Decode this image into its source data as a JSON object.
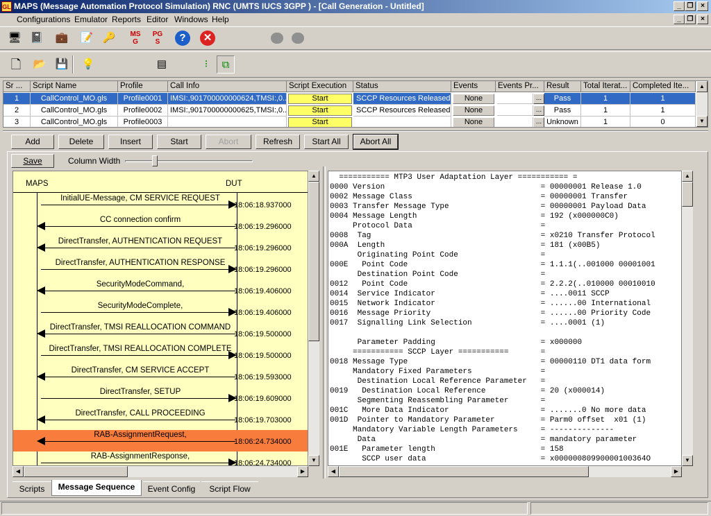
{
  "window": {
    "title": "MAPS (Message Automation Protocol Simulation) RNC (UMTS IUCS 3GPP ) - [Call Generation - Untitled]",
    "logo": "GL"
  },
  "menu": [
    "Configurations",
    "Emulator",
    "Reports",
    "Editor",
    "Windows",
    "Help"
  ],
  "grid": {
    "columns": [
      "Sr ...",
      "Script Name",
      "Profile",
      "Call Info",
      "Script Execution",
      "Status",
      "Events",
      "Events Pr...",
      "Result",
      "Total Iterat...",
      "Completed Ite..."
    ],
    "rows": [
      {
        "sr": "1",
        "script": "CallControl_MO.gls",
        "profile": "Profile0001",
        "callinfo": "IMSI:,901700000000624,TMSI:,0...",
        "exec": "Start",
        "status": "SCCP Resources Released",
        "events": "None",
        "result": "Pass",
        "total": "1",
        "completed": "1"
      },
      {
        "sr": "2",
        "script": "CallControl_MO.gls",
        "profile": "Profile0002",
        "callinfo": "IMSI:,901700000000625,TMSI:,0...",
        "exec": "Start",
        "status": "SCCP Resources Released",
        "events": "None",
        "result": "Pass",
        "total": "1",
        "completed": "1"
      },
      {
        "sr": "3",
        "script": "CallControl_MO.gls",
        "profile": "Profile0003",
        "callinfo": "",
        "exec": "Start",
        "status": "",
        "events": "None",
        "result": "Unknown",
        "total": "1",
        "completed": "0"
      }
    ],
    "ellipsis": "..."
  },
  "buttons": {
    "add": "Add",
    "delete": "Delete",
    "insert": "Insert",
    "start": "Start",
    "abort": "Abort",
    "refresh": "Refresh",
    "start_all": "Start All",
    "abort_all": "Abort All",
    "save": "Save",
    "column_width": "Column Width"
  },
  "sequence": {
    "left": "MAPS",
    "right": "DUT",
    "messages": [
      {
        "label": "InitialUE-Message, CM SERVICE REQUEST",
        "time": "18:06:18.937000",
        "dir": "right"
      },
      {
        "label": "CC connection confirm",
        "time": "18:06:19.296000",
        "dir": "left"
      },
      {
        "label": "DirectTransfer, AUTHENTICATION REQUEST",
        "time": "18:06:19.296000",
        "dir": "left"
      },
      {
        "label": "DirectTransfer, AUTHENTICATION RESPONSE",
        "time": "18:06:19.296000",
        "dir": "right"
      },
      {
        "label": "SecurityModeCommand,",
        "time": "18:06:19.406000",
        "dir": "left"
      },
      {
        "label": "SecurityModeComplete,",
        "time": "18:06:19.406000",
        "dir": "right"
      },
      {
        "label": "DirectTransfer, TMSI REALLOCATION COMMAND",
        "time": "18:06:19.500000",
        "dir": "left"
      },
      {
        "label": "DirectTransfer, TMSI REALLOCATION COMPLETE",
        "time": "18:06:19.500000",
        "dir": "right"
      },
      {
        "label": "DirectTransfer, CM SERVICE ACCEPT",
        "time": "18:06:19.593000",
        "dir": "left"
      },
      {
        "label": "DirectTransfer, SETUP",
        "time": "18:06:19.609000",
        "dir": "right"
      },
      {
        "label": "DirectTransfer, CALL PROCEEDING",
        "time": "18:06:19.703000",
        "dir": "left"
      },
      {
        "label": "RAB-AssignmentRequest,",
        "time": "18:06:24.734000",
        "dir": "left",
        "highlight": true
      },
      {
        "label": "RAB-AssignmentResponse,",
        "time": "18:06:24.734000",
        "dir": "right"
      }
    ]
  },
  "detail": [
    "  =========== MTP3 User Adaptation Layer =========== =",
    "0000 Version                                  = 00000001 Release 1.0",
    "0002 Message Class                            = 00000001 Transfer",
    "0003 Transfer Message Type                    = 00000001 Payload Data",
    "0004 Message Length                           = 192 (x000000C0)",
    "     Protocol Data                            =",
    "0008  Tag                                     = x0210 Transfer Protocol",
    "000A  Length                                  = 181 (x00B5)",
    "      Originating Point Code                  =",
    "000E   Point Code                             = 1.1.1(..001000 00001001",
    "      Destination Point Code                  =",
    "0012   Point Code                             = 2.2.2(..010000 00010010",
    "0014  Service Indicator                       = ....0011 SCCP",
    "0015  Network Indicator                       = ......00 International",
    "0016  Message Priority                        = ......00 Priority Code",
    "0017  Signalling Link Selection               = ....0001 (1)",
    "",
    "      Parameter Padding                       = x000000",
    "     =========== SCCP Layer ===========       =",
    "0018 Message Type                             = 00000110 DT1 data form",
    "     Mandatory Fixed Parameters               =",
    "      Destination Local Reference Parameter   =",
    "0019   Destination Local Reference            = 20 (x000014)",
    "      Segmenting Reassembling Parameter       =",
    "001C   More Data Indicator                    = .......0 No more data",
    "001D  Pointer to Mandatory Parameter          = Parm0 offset  x01 (1)",
    "     Mandatory Variable Length Parameters     = --------------",
    "      Data                                    = mandatory parameter",
    "001E   Parameter length                       = 158",
    "       SCCP user data                         = x00000080990000100364O"
  ],
  "tabs": [
    "Scripts",
    "Message Sequence",
    "Event Config",
    "Script Flow"
  ],
  "colors": {
    "accent": "#316ac5",
    "highlight": "#f87c3c",
    "seq_bg": "#ffffc0"
  }
}
